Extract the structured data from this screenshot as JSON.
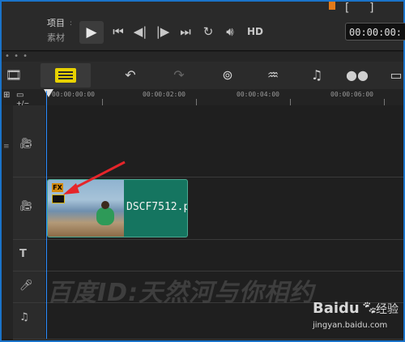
{
  "player": {
    "mode_project": "项目",
    "mode_clip": "素材",
    "hd_label": "HD",
    "timecode": "00:00:00:",
    "bracket_in": "[",
    "bracket_out": "]"
  },
  "separator": {
    "dots": "• • •"
  },
  "ruler": {
    "labels": [
      "00:00:00:00",
      "00:00:02:00",
      "00:00:04:00",
      "00:00:06:00"
    ]
  },
  "timeline": {
    "clip_label": "DSCF7512.p",
    "fx_badge": "FX",
    "plus_minus": "+/−"
  },
  "watermark": {
    "text": "百度ID:天然河与你相约",
    "brand": "Baidu",
    "brand_cn": "经验",
    "url": "jingyan.baidu.com"
  },
  "colors": {
    "accent": "#1a73c9",
    "clip": "#157560",
    "playhead": "#2a8cff",
    "arrow": "#e5252a"
  }
}
